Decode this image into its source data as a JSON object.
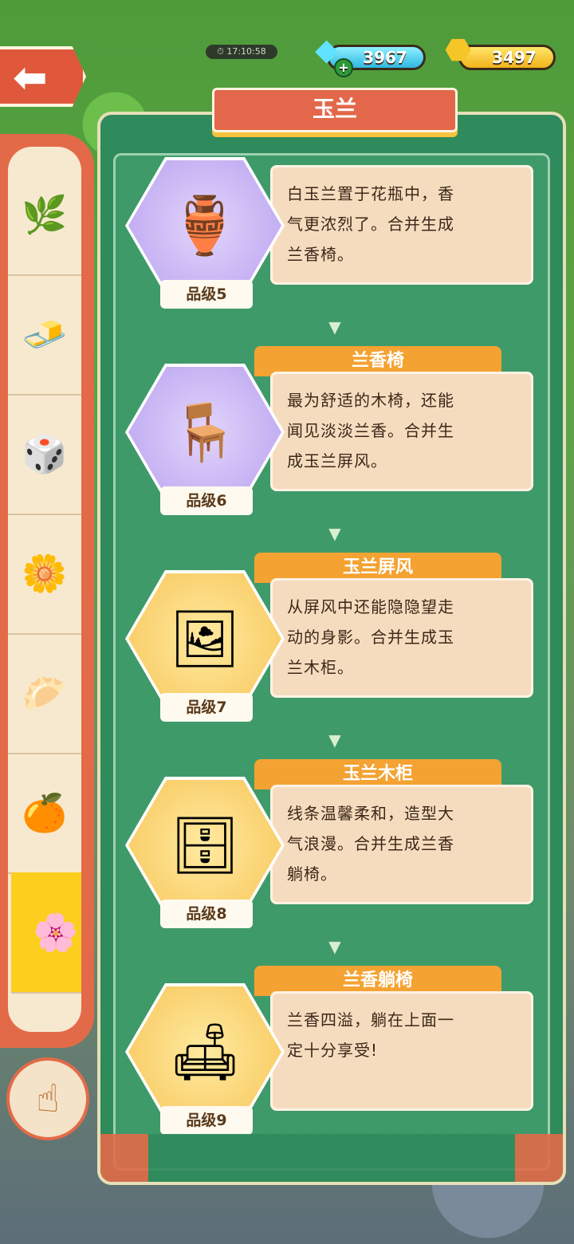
{
  "header": {
    "timer": "17:10:58",
    "gems": "3967",
    "gold": "3497",
    "title": "玉兰"
  },
  "icons": {
    "back": "back-arrow-icon",
    "gem": "diamond-icon",
    "gold": "gold-ingot-icon",
    "hint": "pointing-hand-icon"
  },
  "sidebar": {
    "items": [
      {
        "name": "branch",
        "glyph": "🌿"
      },
      {
        "name": "tofu",
        "glyph": "🧈"
      },
      {
        "name": "dice",
        "glyph": "🎲"
      },
      {
        "name": "flower-sprig",
        "glyph": "🌼"
      },
      {
        "name": "dumpling",
        "glyph": "🥟"
      },
      {
        "name": "orange-tree",
        "glyph": "🍊"
      },
      {
        "name": "magnolia",
        "glyph": "🌸",
        "active": true
      }
    ]
  },
  "cards": [
    {
      "name": "",
      "desc_lines": [
        "白玉兰置于花瓶中，香",
        "气更浓烈了。合并生成",
        "兰香椅。"
      ],
      "grade": "品级5",
      "glyph": "🏺",
      "theme": "purple"
    },
    {
      "name": "兰香椅",
      "desc_lines": [
        "最为舒适的木椅，还能",
        "闻见淡淡兰香。合并生",
        "成玉兰屏风。"
      ],
      "grade": "品级6",
      "glyph": "🪑",
      "theme": "purple"
    },
    {
      "name": "玉兰屏风",
      "desc_lines": [
        "从屏风中还能隐隐望走",
        "动的身影。合并生成玉",
        "兰木柜。"
      ],
      "grade": "品级7",
      "glyph": "🖼",
      "theme": "gold"
    },
    {
      "name": "玉兰木柜",
      "desc_lines": [
        "线条温馨柔和，造型大",
        "气浪漫。合并生成兰香",
        "躺椅。"
      ],
      "grade": "品级8",
      "glyph": "🗄",
      "theme": "gold"
    },
    {
      "name": "兰香躺椅",
      "desc_lines": [
        "兰香四溢，躺在上面一",
        "定十分享受!"
      ],
      "grade": "品级9",
      "glyph": "🛋",
      "theme": "gold"
    }
  ]
}
